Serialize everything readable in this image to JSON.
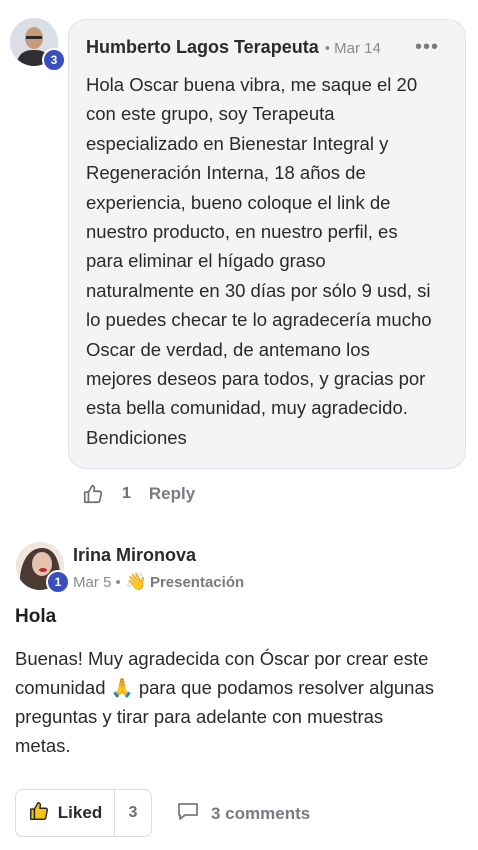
{
  "comment": {
    "author": "Humberto Lagos Terapeuta",
    "date": "• Mar 14",
    "level": "3",
    "more_icon": "more-horizontal-icon",
    "text_lines": [
      "Hola Oscar buena vibra, me saque el 20",
      "con este grupo, soy Terapeuta",
      "especializado en Bienestar Integral y",
      "Regeneración Interna, 18 años de",
      "experiencia, bueno coloque el link de",
      "nuestro producto, en nuestro perfil, es",
      "para eliminar el hígado graso",
      "naturalmente en 30 días por sólo 9 usd, si",
      "lo puedes checar te lo agradecería mucho",
      "Oscar de verdad, de antemano los",
      "mejores deseos para todos, y gracias por",
      "esta bella comunidad, muy agradecido.",
      "Bendiciones"
    ],
    "likes": "1",
    "reply_label": "Reply"
  },
  "post": {
    "author": "Irina Mironova",
    "level": "1",
    "date": "Mar 5 •",
    "category_emoji": "👋",
    "category": "Presentación",
    "title": "Hola",
    "body_lines": [
      "Buenas! Muy agradecida con Óscar por crear este",
      "comunidad 🙏 para que podamos resolver algunas",
      "preguntas y tirar para adelante con muestras",
      "metas."
    ],
    "liked_label": "Liked",
    "like_count": "3",
    "comments_label": "3 comments"
  },
  "colors": {
    "badge": "#3a4fbd",
    "bubble_bg": "#f4f4f6",
    "muted": "#7a7a80"
  }
}
